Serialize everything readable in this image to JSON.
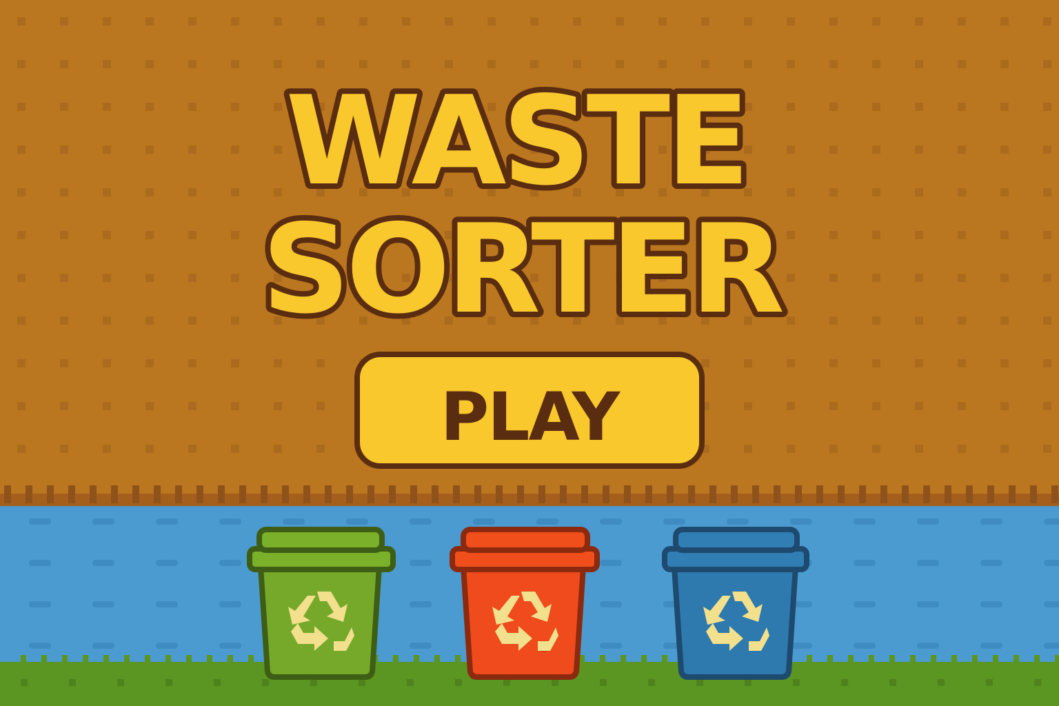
{
  "title": {
    "line1": "WASTE",
    "line2": "SORTER"
  },
  "play_button": {
    "label": "PLAY"
  },
  "colors": {
    "sky": "#bb771f",
    "sky_dots": "#a8661e",
    "title_fill": "#f9c82d",
    "outline": "#5b2d10",
    "water": "#4c9bd0",
    "water_dash": "#3f8cc2",
    "grass": "#5b9522",
    "green_bin": "#76a92a",
    "red_bin": "#ef4b1c",
    "blue_bin": "#2e79ae",
    "recycle_symbol": "#f2e08c"
  },
  "bins": [
    {
      "name": "green-bin",
      "icon": "recycle-icon"
    },
    {
      "name": "red-bin",
      "icon": "recycle-icon"
    },
    {
      "name": "blue-bin",
      "icon": "recycle-icon"
    }
  ]
}
